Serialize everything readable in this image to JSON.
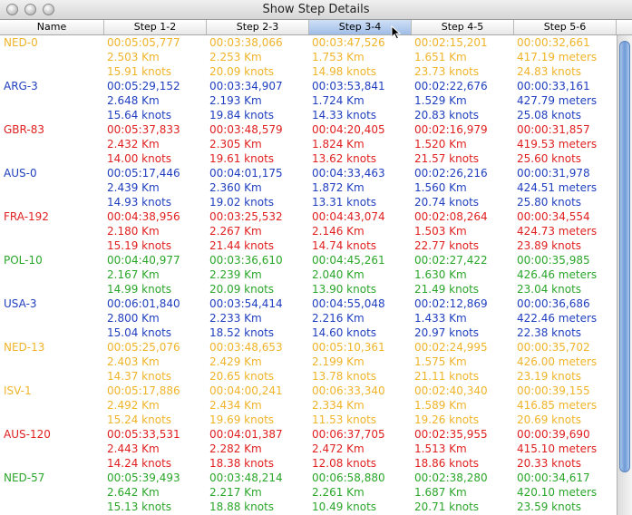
{
  "window": {
    "title": "Show Step Details"
  },
  "columns": [
    "Name",
    "Step 1-2",
    "Step 2-3",
    "Step 3-4",
    "Step 4-5",
    "Step 5-6"
  ],
  "colors": {
    "yellow": "#f0b429",
    "blue": "#1f3fbf",
    "red": "#e02020",
    "green": "#2aa62a"
  },
  "rows": [
    {
      "name": "NED-0",
      "color": "yellow",
      "steps": [
        [
          "00:05:05,777",
          "2.503 Km",
          "15.91 knots"
        ],
        [
          "00:03:38,066",
          "2.253 Km",
          "20.09 knots"
        ],
        [
          "00:03:47,526",
          "1.753 Km",
          "14.98 knots"
        ],
        [
          "00:02:15,201",
          "1.651 Km",
          "23.73 knots"
        ],
        [
          "00:00:32,661",
          "417.19 meters",
          "24.83 knots"
        ]
      ]
    },
    {
      "name": "ARG-3",
      "color": "blue",
      "steps": [
        [
          "00:05:29,152",
          "2.648 Km",
          "15.64 knots"
        ],
        [
          "00:03:34,907",
          "2.193 Km",
          "19.84 knots"
        ],
        [
          "00:03:53,841",
          "1.724 Km",
          "14.33 knots"
        ],
        [
          "00:02:22,676",
          "1.529 Km",
          "20.83 knots"
        ],
        [
          "00:00:33,161",
          "427.79 meters",
          "25.08 knots"
        ]
      ]
    },
    {
      "name": "GBR-83",
      "color": "red",
      "steps": [
        [
          "00:05:37,833",
          "2.432 Km",
          "14.00 knots"
        ],
        [
          "00:03:48,579",
          "2.305 Km",
          "19.61 knots"
        ],
        [
          "00:04:20,405",
          "1.824 Km",
          "13.62 knots"
        ],
        [
          "00:02:16,979",
          "1.520 Km",
          "21.57 knots"
        ],
        [
          "00:00:31,857",
          "419.53 meters",
          "25.60 knots"
        ]
      ]
    },
    {
      "name": "AUS-0",
      "color": "blue",
      "steps": [
        [
          "00:05:17,446",
          "2.439 Km",
          "14.93 knots"
        ],
        [
          "00:04:01,175",
          "2.360 Km",
          "19.02 knots"
        ],
        [
          "00:04:33,463",
          "1.872 Km",
          "13.31 knots"
        ],
        [
          "00:02:26,216",
          "1.560 Km",
          "20.74 knots"
        ],
        [
          "00:00:31,978",
          "424.51 meters",
          "25.80 knots"
        ]
      ]
    },
    {
      "name": "FRA-192",
      "color": "red",
      "steps": [
        [
          "00:04:38,956",
          "2.180 Km",
          "15.19 knots"
        ],
        [
          "00:03:25,532",
          "2.267 Km",
          "21.44 knots"
        ],
        [
          "00:04:43,074",
          "2.146 Km",
          "14.74 knots"
        ],
        [
          "00:02:08,264",
          "1.503 Km",
          "22.77 knots"
        ],
        [
          "00:00:34,554",
          "424.73 meters",
          "23.89 knots"
        ]
      ]
    },
    {
      "name": "POL-10",
      "color": "green",
      "steps": [
        [
          "00:04:40,977",
          "2.167 Km",
          "14.99 knots"
        ],
        [
          "00:03:36,610",
          "2.239 Km",
          "20.09 knots"
        ],
        [
          "00:04:45,261",
          "2.040 Km",
          "13.90 knots"
        ],
        [
          "00:02:27,422",
          "1.630 Km",
          "21.49 knots"
        ],
        [
          "00:00:35,985",
          "426.46 meters",
          "23.04 knots"
        ]
      ]
    },
    {
      "name": "USA-3",
      "color": "blue",
      "steps": [
        [
          "00:06:01,840",
          "2.800 Km",
          "15.04 knots"
        ],
        [
          "00:03:54,414",
          "2.233 Km",
          "18.52 knots"
        ],
        [
          "00:04:55,048",
          "2.216 Km",
          "14.60 knots"
        ],
        [
          "00:02:12,869",
          "1.433 Km",
          "20.97 knots"
        ],
        [
          "00:00:36,686",
          "422.46 meters",
          "22.38 knots"
        ]
      ]
    },
    {
      "name": "NED-13",
      "color": "yellow",
      "steps": [
        [
          "00:05:25,076",
          "2.403 Km",
          "14.37 knots"
        ],
        [
          "00:03:48,653",
          "2.429 Km",
          "20.65 knots"
        ],
        [
          "00:05:10,361",
          "2.199 Km",
          "13.78 knots"
        ],
        [
          "00:02:24,995",
          "1.575 Km",
          "21.11 knots"
        ],
        [
          "00:00:35,702",
          "426.00 meters",
          "23.19 knots"
        ]
      ]
    },
    {
      "name": "ISV-1",
      "color": "yellow",
      "steps": [
        [
          "00:05:17,886",
          "2.492 Km",
          "15.24 knots"
        ],
        [
          "00:04:00,241",
          "2.434 Km",
          "19.69 knots"
        ],
        [
          "00:06:33,340",
          "2.334 Km",
          "11.53 knots"
        ],
        [
          "00:02:40,340",
          "1.589 Km",
          "19.26 knots"
        ],
        [
          "00:00:39,155",
          "416.85 meters",
          "20.69 knots"
        ]
      ]
    },
    {
      "name": "AUS-120",
      "color": "red",
      "steps": [
        [
          "00:05:33,531",
          "2.443 Km",
          "14.24 knots"
        ],
        [
          "00:04:01,387",
          "2.282 Km",
          "18.38 knots"
        ],
        [
          "00:06:37,705",
          "2.472 Km",
          "12.08 knots"
        ],
        [
          "00:02:35,955",
          "1.513 Km",
          "18.86 knots"
        ],
        [
          "00:00:39,690",
          "415.10 meters",
          "20.33 knots"
        ]
      ]
    },
    {
      "name": "NED-57",
      "color": "green",
      "steps": [
        [
          "00:05:39,493",
          "2.642 Km",
          "15.13 knots"
        ],
        [
          "00:03:48,214",
          "2.217 Km",
          "18.88 knots"
        ],
        [
          "00:06:58,880",
          "2.261 Km",
          "10.49 knots"
        ],
        [
          "00:02:38,280",
          "1.687 Km",
          "20.71 knots"
        ],
        [
          "00:00:34,617",
          "420.10 meters",
          "23.59 knots"
        ]
      ]
    }
  ]
}
